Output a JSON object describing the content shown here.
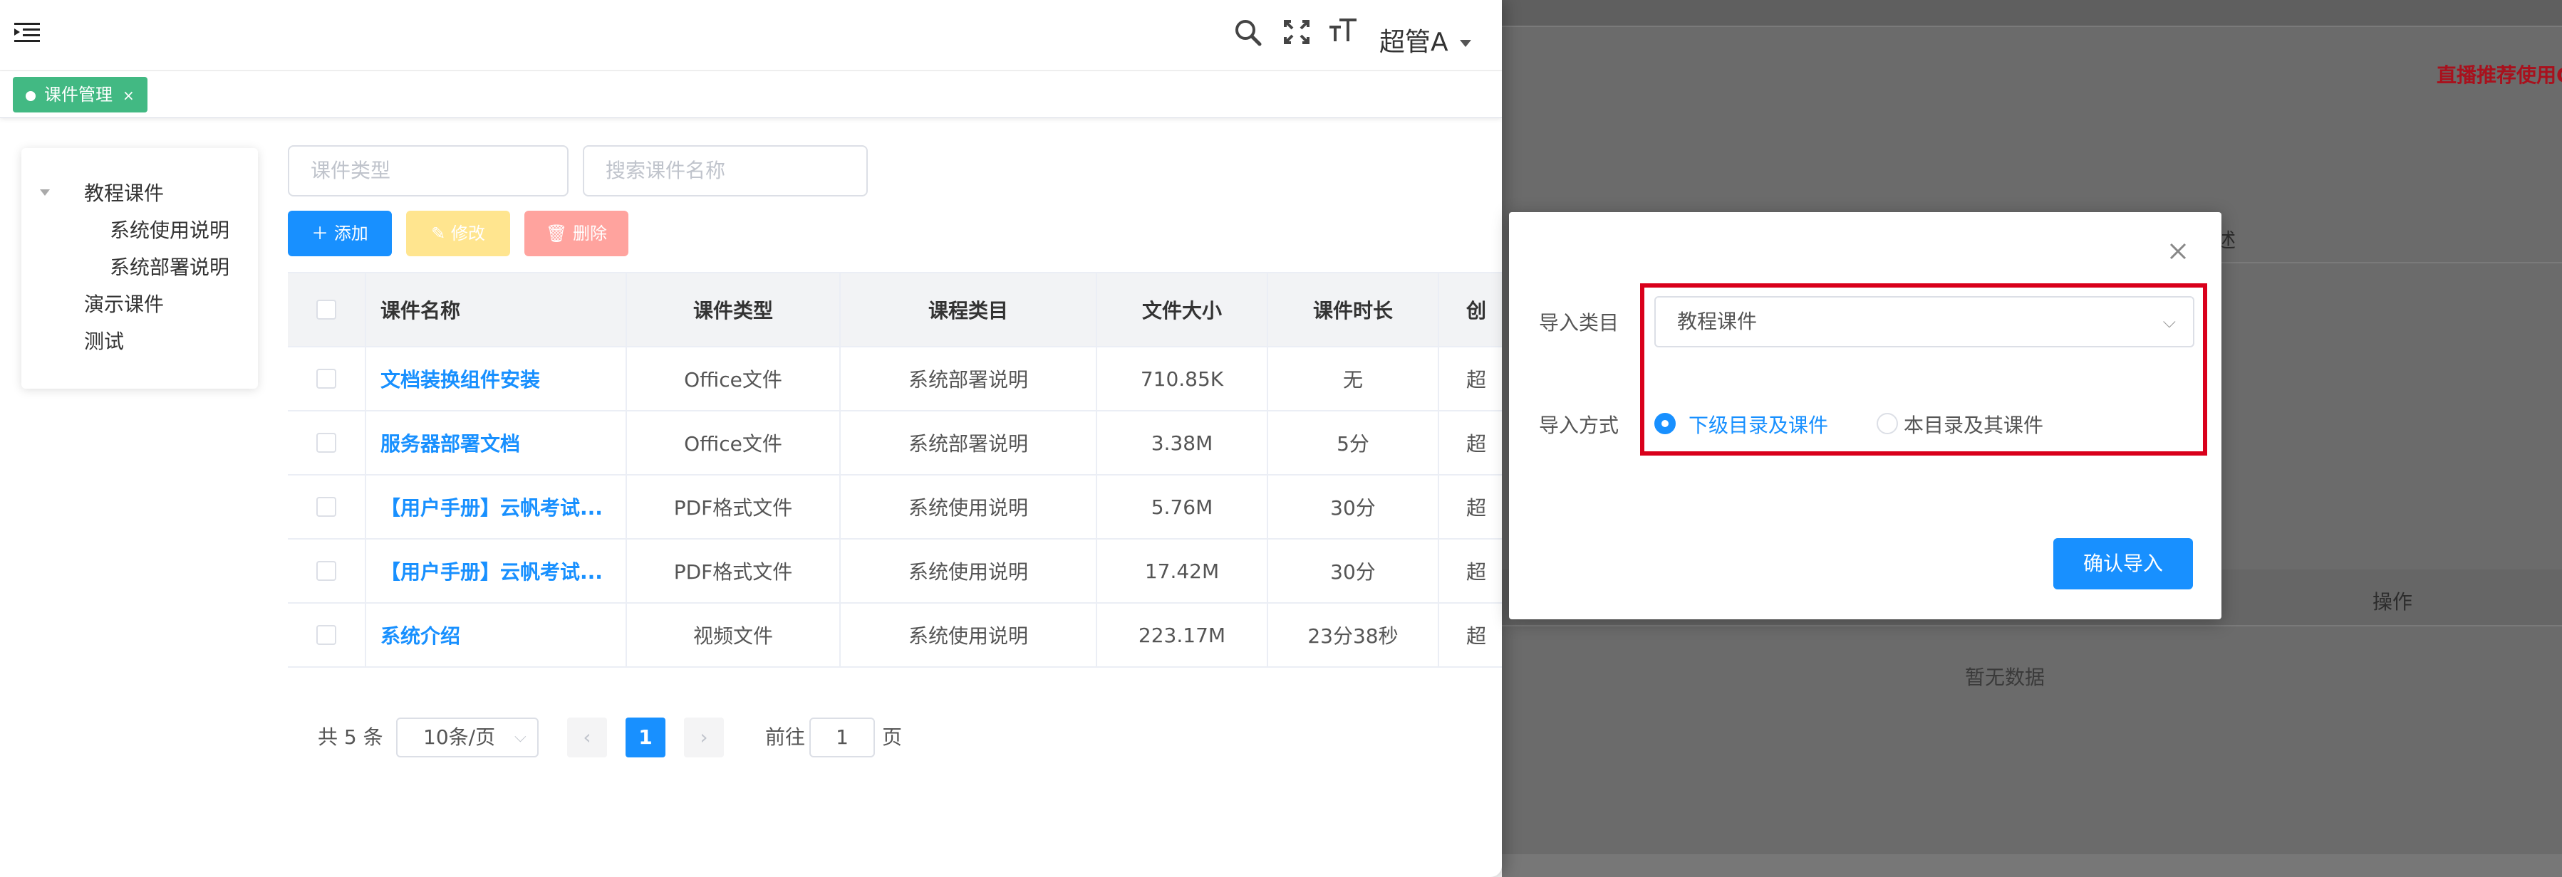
{
  "header": {
    "user_name": "超管A",
    "icons": [
      "menu-fold-icon",
      "search-icon",
      "fullscreen-icon",
      "font-size-icon",
      "caret-down-icon"
    ]
  },
  "tags": [
    {
      "label": "课件管理",
      "close": "×",
      "color": "#42b983"
    }
  ],
  "tree": {
    "nodes": [
      {
        "label": "教程课件",
        "children": [
          {
            "label": "系统使用说明"
          },
          {
            "label": "系统部署说明"
          }
        ]
      },
      {
        "label": "演示课件"
      },
      {
        "label": "测试"
      }
    ]
  },
  "filters": {
    "type_placeholder": "课件类型",
    "search_placeholder": "搜索课件名称"
  },
  "toolbar": {
    "add": "添加",
    "edit": "修改",
    "delete": "删除",
    "colors": {
      "add": "#1890ff",
      "edit": "#ffe58f",
      "delete": "#ffa39e"
    }
  },
  "table": {
    "columns": [
      "课件名称",
      "课件类型",
      "课程类目",
      "文件大小",
      "课件时长",
      "创"
    ],
    "rows": [
      {
        "name": "文档装换组件安装",
        "type": "Office文件",
        "category": "系统部署说明",
        "size": "710.85K",
        "duration": "无",
        "extra": "超"
      },
      {
        "name": "服务器部署文档",
        "type": "Office文件",
        "category": "系统部署说明",
        "size": "3.38M",
        "duration": "5分",
        "extra": "超"
      },
      {
        "name": "【用户手册】云帆考试...",
        "type": "PDF格式文件",
        "category": "系统使用说明",
        "size": "5.76M",
        "duration": "30分",
        "extra": "超"
      },
      {
        "name": "【用户手册】云帆考试...",
        "type": "PDF格式文件",
        "category": "系统使用说明",
        "size": "17.42M",
        "duration": "30分",
        "extra": "超"
      },
      {
        "name": "系统介绍",
        "type": "视频文件",
        "category": "系统使用说明",
        "size": "223.17M",
        "duration": "23分38秒",
        "extra": "超"
      }
    ]
  },
  "pagination": {
    "total": "共 5 条",
    "page_size": "10条/页",
    "prev": "‹",
    "current": "1",
    "next": "›",
    "goto_prefix": "前往",
    "goto_value": "1",
    "goto_suffix": "页"
  },
  "background": {
    "red_text": "直播推荐使用C",
    "col_desc": "述",
    "col_ops": "操作",
    "empty": "暂无数据"
  },
  "dialog": {
    "category_label": "导入类目",
    "category_value": "教程课件",
    "method_label": "导入方式",
    "options": [
      "下级目录及课件",
      "本目录及其课件"
    ],
    "selected": 0,
    "confirm": "确认导入",
    "close_icon": "close-icon",
    "highlight_color": "#d9001b"
  }
}
